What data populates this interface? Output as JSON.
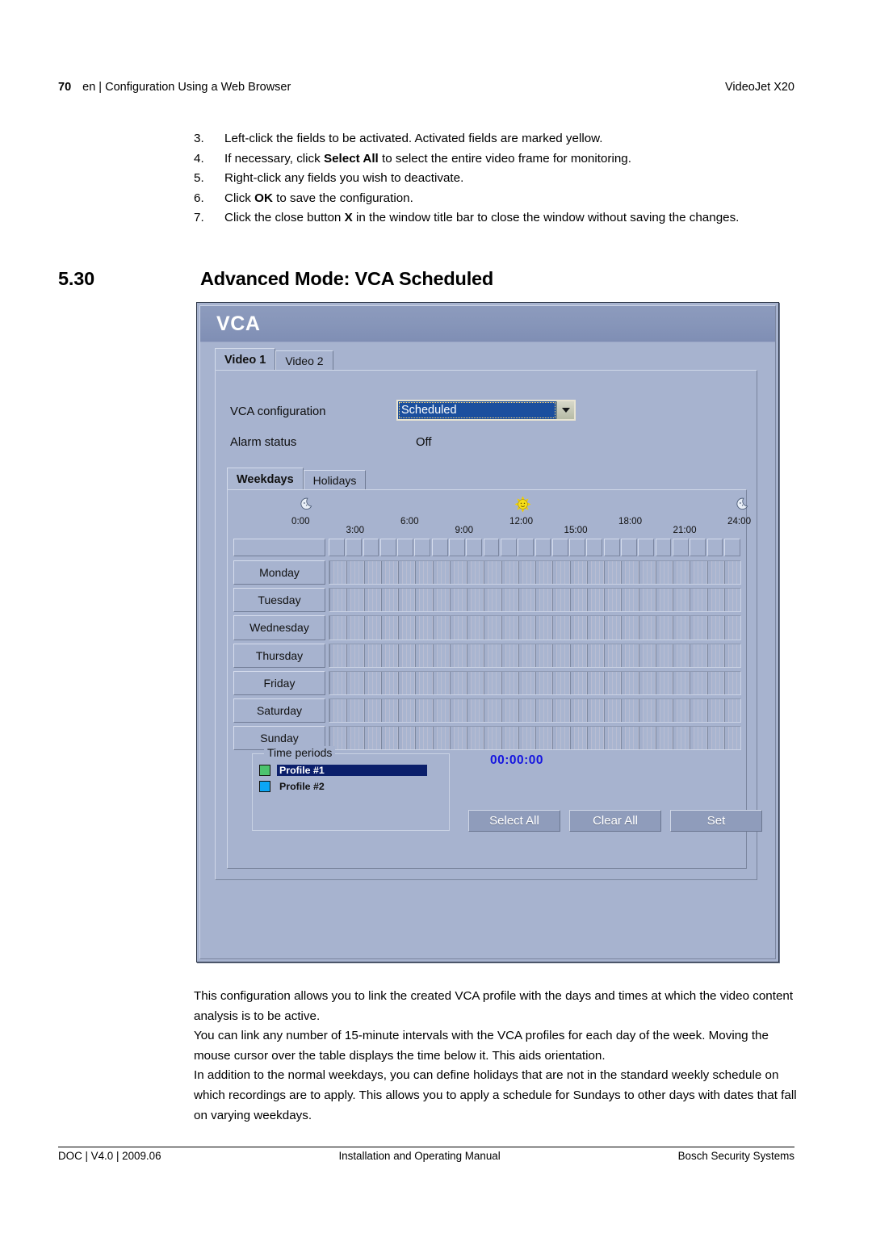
{
  "header": {
    "page_number": "70",
    "left_text": "en | Configuration Using a Web Browser",
    "right_text": "VideoJet X20"
  },
  "steps": [
    {
      "num": "3.",
      "parts": [
        {
          "t": "Left-click the fields to be activated. Activated fields are marked yellow.",
          "b": false
        }
      ]
    },
    {
      "num": "4.",
      "parts": [
        {
          "t": "If necessary, click ",
          "b": false
        },
        {
          "t": "Select All",
          "b": true
        },
        {
          "t": " to select the entire video frame for monitoring.",
          "b": false
        }
      ]
    },
    {
      "num": "5.",
      "parts": [
        {
          "t": "Right-click any fields you wish to deactivate.",
          "b": false
        }
      ]
    },
    {
      "num": "6.",
      "parts": [
        {
          "t": "Click ",
          "b": false
        },
        {
          "t": "OK",
          "b": true
        },
        {
          "t": " to save the configuration.",
          "b": false
        }
      ]
    },
    {
      "num": "7.",
      "parts": [
        {
          "t": "Click the close button ",
          "b": false
        },
        {
          "t": "X",
          "b": true
        },
        {
          "t": " in the window title bar to close the window without saving the changes.",
          "b": false
        }
      ]
    }
  ],
  "section": {
    "number": "5.30",
    "title": "Advanced Mode: VCA Scheduled"
  },
  "vca": {
    "window_title": "VCA",
    "video_tabs": [
      {
        "label": "Video 1",
        "active": true
      },
      {
        "label": "Video 2",
        "active": false
      }
    ],
    "vca_configuration_label": "VCA configuration",
    "vca_configuration_value": "Scheduled",
    "alarm_status_label": "Alarm status",
    "alarm_status_value": "Off",
    "schedule_tabs": [
      {
        "label": "Weekdays",
        "active": true
      },
      {
        "label": "Holidays",
        "active": false
      }
    ],
    "time_ticks": [
      "0:00",
      "3:00",
      "6:00",
      "9:00",
      "12:00",
      "15:00",
      "18:00",
      "21:00",
      "24:00"
    ],
    "axis_icons": [
      {
        "name": "moon-icon",
        "at": "0:00"
      },
      {
        "name": "sun-icon",
        "at": "12:00"
      },
      {
        "name": "moon-icon",
        "at": "24:00"
      }
    ],
    "days": [
      "Monday",
      "Tuesday",
      "Wednesday",
      "Thursday",
      "Friday",
      "Saturday",
      "Sunday"
    ],
    "hour_columns": 24,
    "quarters_per_hour": 4,
    "time_periods": {
      "group_label": "Time periods",
      "profiles": [
        {
          "label": "Profile #1",
          "color": "#4cc46e",
          "selected": true
        },
        {
          "label": "Profile #2",
          "color": "#0ba6f5",
          "selected": false
        }
      ]
    },
    "time_readout": "00:00:00",
    "time_readout_color": "#1414e0",
    "buttons": [
      {
        "label": "Select All"
      },
      {
        "label": "Clear All"
      },
      {
        "label": "Set"
      }
    ]
  },
  "body_paragraphs": [
    "This configuration allows you to link the created VCA profile with the days and times at which the video content analysis is to be active.",
    "You can link any number of 15-minute intervals with the VCA profiles for each day of the week. Moving the mouse cursor over the table displays the time below it. This aids orientation.",
    "In addition to the normal weekdays, you can define holidays that are not in the standard weekly schedule on which recordings are to apply. This allows you to apply a schedule for Sundays to other days with dates that fall on varying weekdays."
  ],
  "footer": {
    "left": "DOC | V4.0 | 2009.06",
    "center": "Installation and Operating Manual",
    "right": "Bosch Security Systems"
  }
}
